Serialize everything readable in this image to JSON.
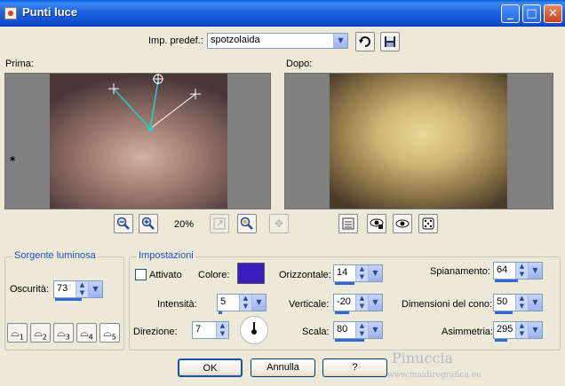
{
  "window": {
    "title": "Punti luce",
    "help_label": "?",
    "minimize_label": "_",
    "maximize_label": "□",
    "close_label": "✕"
  },
  "preset": {
    "label": "Imp. predef.:",
    "value": "spotzolaida"
  },
  "preview": {
    "before_label": "Prima:",
    "after_label": "Dopo:",
    "zoom": "20%"
  },
  "light_source": {
    "group_label": "Sorgente luminosa",
    "darkness_label": "Oscurità:",
    "darkness_value": "73",
    "light_numbers": [
      "1",
      "2",
      "3",
      "4",
      "5"
    ]
  },
  "settings": {
    "group_label": "Impostazioni",
    "enabled_label": "Attivato",
    "color_label": "Colore:",
    "color_value": "#3a1dbf",
    "intensity_label": "Intensità:",
    "intensity_value": "5",
    "direction_label": "Direzione:",
    "direction_value": "7",
    "horizontal_label": "Orizzontale:",
    "horizontal_value": "14",
    "vertical_label": "Verticale:",
    "vertical_value": "-20",
    "scale_label": "Scala:",
    "scale_value": "80",
    "flatten_label": "Spianamento:",
    "flatten_value": "64",
    "cone_label": "Dimensioni del cono:",
    "cone_value": "50",
    "asymmetry_label": "Asimmetria:",
    "asymmetry_value": "295"
  },
  "buttons": {
    "ok": "OK",
    "cancel": "Annulla",
    "help": "?"
  },
  "watermark": {
    "name": "Pinuccia",
    "site": "www.maidiregrafica.eu"
  }
}
